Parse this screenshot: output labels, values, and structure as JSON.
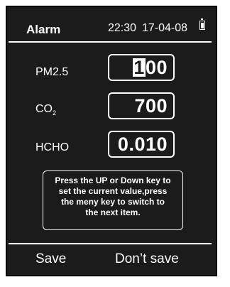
{
  "header": {
    "title": "Alarm",
    "time": "22:30",
    "date": "17-04-08",
    "battery_icon": "battery-full-icon"
  },
  "rows": [
    {
      "label": "PM2.5",
      "value_cursor": "1",
      "value_rest": "00"
    },
    {
      "label_main": "CO",
      "label_sub": "2",
      "value": "700"
    },
    {
      "label": "HCHO",
      "value": "0.010"
    }
  ],
  "help": {
    "line1": "Press the UP or Down key to",
    "line2": "set the current value,press",
    "line3": "the meny key to switch to",
    "line4": "the next item."
  },
  "softkeys": {
    "left": "Save",
    "right": "Don’t save"
  },
  "colors": {
    "screen_background": "#1b1b1b",
    "foreground": "#ffffff"
  }
}
